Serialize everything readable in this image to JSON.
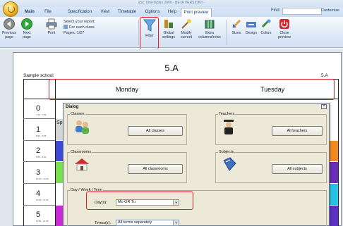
{
  "window": {
    "title": "aSc TimeTables 2009 - BETA VERSION!! -"
  },
  "tabs": [
    {
      "label": "Main",
      "active": false
    },
    {
      "label": "File",
      "active": false
    },
    {
      "label": "Specification",
      "active": false
    },
    {
      "label": "View",
      "active": false
    },
    {
      "label": "Timetable",
      "active": false
    },
    {
      "label": "Options",
      "active": false
    },
    {
      "label": "Help",
      "active": false
    },
    {
      "label": "Print preview",
      "active": true
    }
  ],
  "find": {
    "label": "Find:",
    "value": ""
  },
  "customize_label": "Customize",
  "toolbar": {
    "previous_page": "Previous page",
    "next_page": "Next page",
    "print": "Print",
    "select_report": "Select your report:",
    "for_each_class": "For each class",
    "pages": "Pages: 1/27",
    "filter": "Filter",
    "global_settings": "Global settings",
    "modify_current": "Modify current",
    "extra_columns_rows": "Extra columns/rows",
    "sizes": "Sizes",
    "design": "Design",
    "colors": "Colors",
    "close_preview": "Close preview"
  },
  "document": {
    "class_title": "5.A",
    "school": "Sample school",
    "page_number": "5.A",
    "days": [
      "Monday",
      "Tuesday"
    ],
    "periods": [
      {
        "number": "0",
        "time": "7:10 - 7:55"
      },
      {
        "number": "1",
        "time": "8:00 - 8:45"
      },
      {
        "number": "2",
        "time": "8:55 - 9:40"
      },
      {
        "number": "3",
        "time": "10:00 - 10:45"
      },
      {
        "number": "4",
        "time": "10:55 - 11:40"
      },
      {
        "number": "5",
        "time": "11:50 - 12:35"
      }
    ],
    "lesson_fragment": "Sp"
  },
  "dialog": {
    "title": "Dialog",
    "classes": {
      "group": "Classes",
      "button": "All classes"
    },
    "teachers": {
      "group": "Teachers",
      "button": "All teachers"
    },
    "classrooms": {
      "group": "Classrooms",
      "button": "All classrooms"
    },
    "subjects": {
      "group": "Subjects",
      "button": "All subjects"
    },
    "day_week_term": {
      "group": "Day / Week / Term",
      "days_label": "Day(s):",
      "days_value": "Mo OR Tu",
      "terms_label": "Terms(s):",
      "terms_value": "All terms separately"
    }
  },
  "colors": {
    "highlight": "#e01b24",
    "ribbon": "#d3e1f3",
    "dialog": "#ece9d8"
  }
}
